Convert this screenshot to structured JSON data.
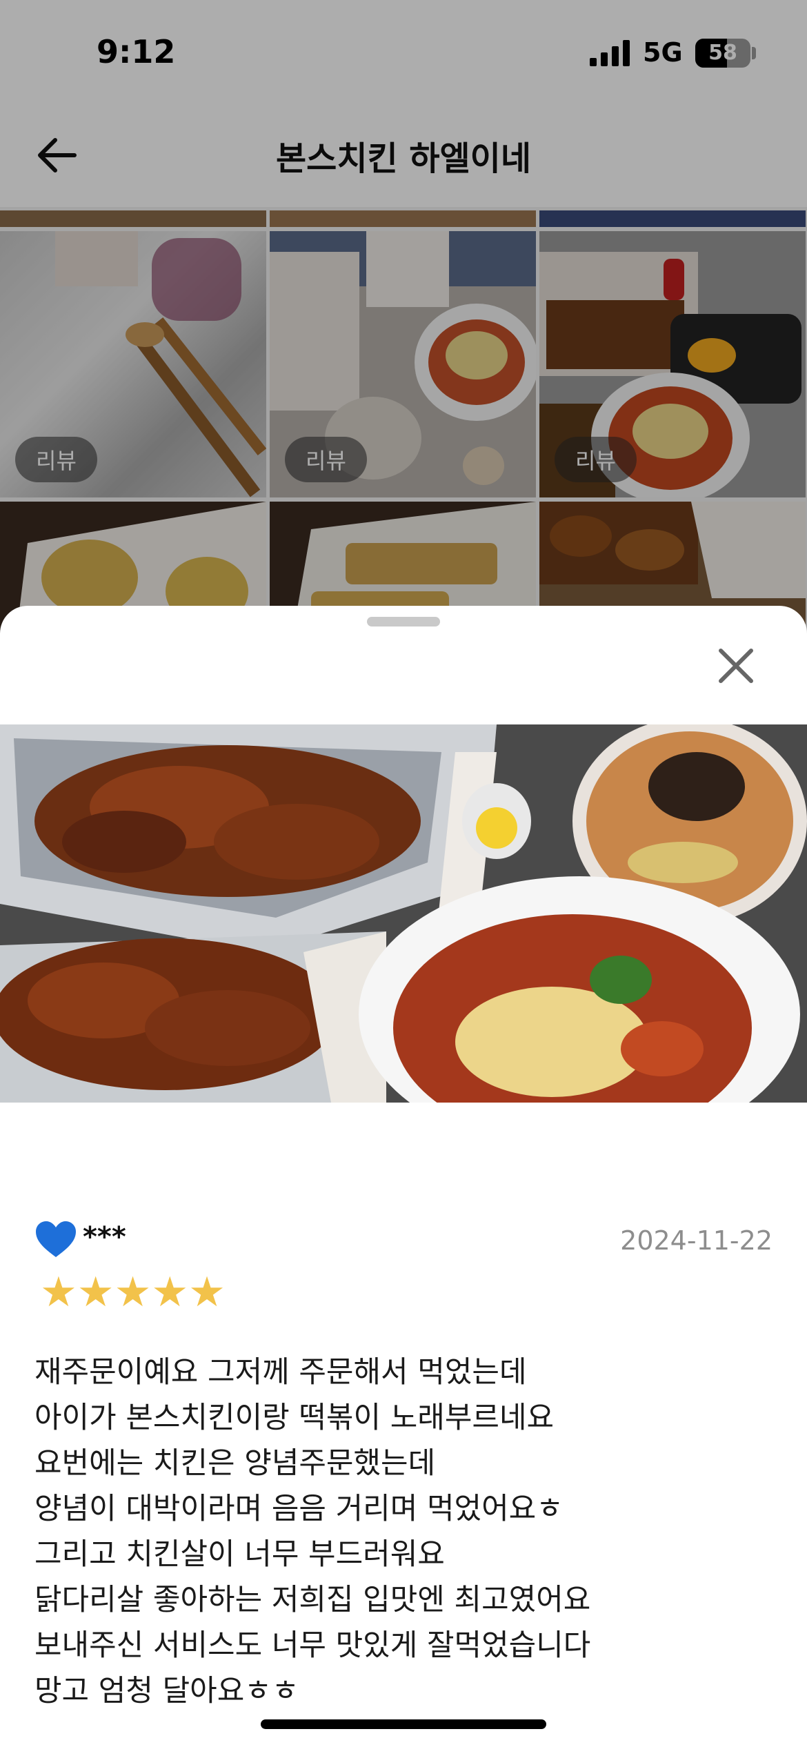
{
  "status_bar": {
    "time": "9:12",
    "network": "5G",
    "battery": "58",
    "battery_level_percent": 58
  },
  "nav": {
    "title": "본스치킨 하엘이네",
    "back_icon": "arrow-left-icon"
  },
  "grid": {
    "tiles": [
      {
        "label": "리뷰"
      },
      {
        "label": "리뷰"
      },
      {
        "label": "리뷰"
      },
      {
        "label": ""
      },
      {
        "label": ""
      },
      {
        "label": ""
      }
    ]
  },
  "sheet": {
    "close_icon": "close-icon",
    "photo_alt": "fried chicken and tteokbokki",
    "review": {
      "heart_icon": "blue-heart-icon",
      "reviewer": "***",
      "date": "2024-11-22",
      "rating": 5,
      "stars": "★★★★★",
      "lines": [
        "재주문이예요 그저께 주문해서 먹었는데",
        "아이가 본스치킨이랑 떡볶이 노래부르네요",
        "요번에는 치킨은 양념주문했는데",
        "양념이 대박이라며 음음 거리며 먹었어요ㅎ",
        "그리고 치킨살이 너무 부드러워요",
        "닭다리살 좋아하는 저희집 입맛엔 최고였어요",
        "보내주신 서비스도 너무 맛있게 잘먹었습니다",
        "망고 엄청 달아요ㅎㅎ"
      ]
    }
  },
  "colors": {
    "star": "#f2c24a",
    "date": "#8d8d8d",
    "heart": "#1e6fd9"
  }
}
